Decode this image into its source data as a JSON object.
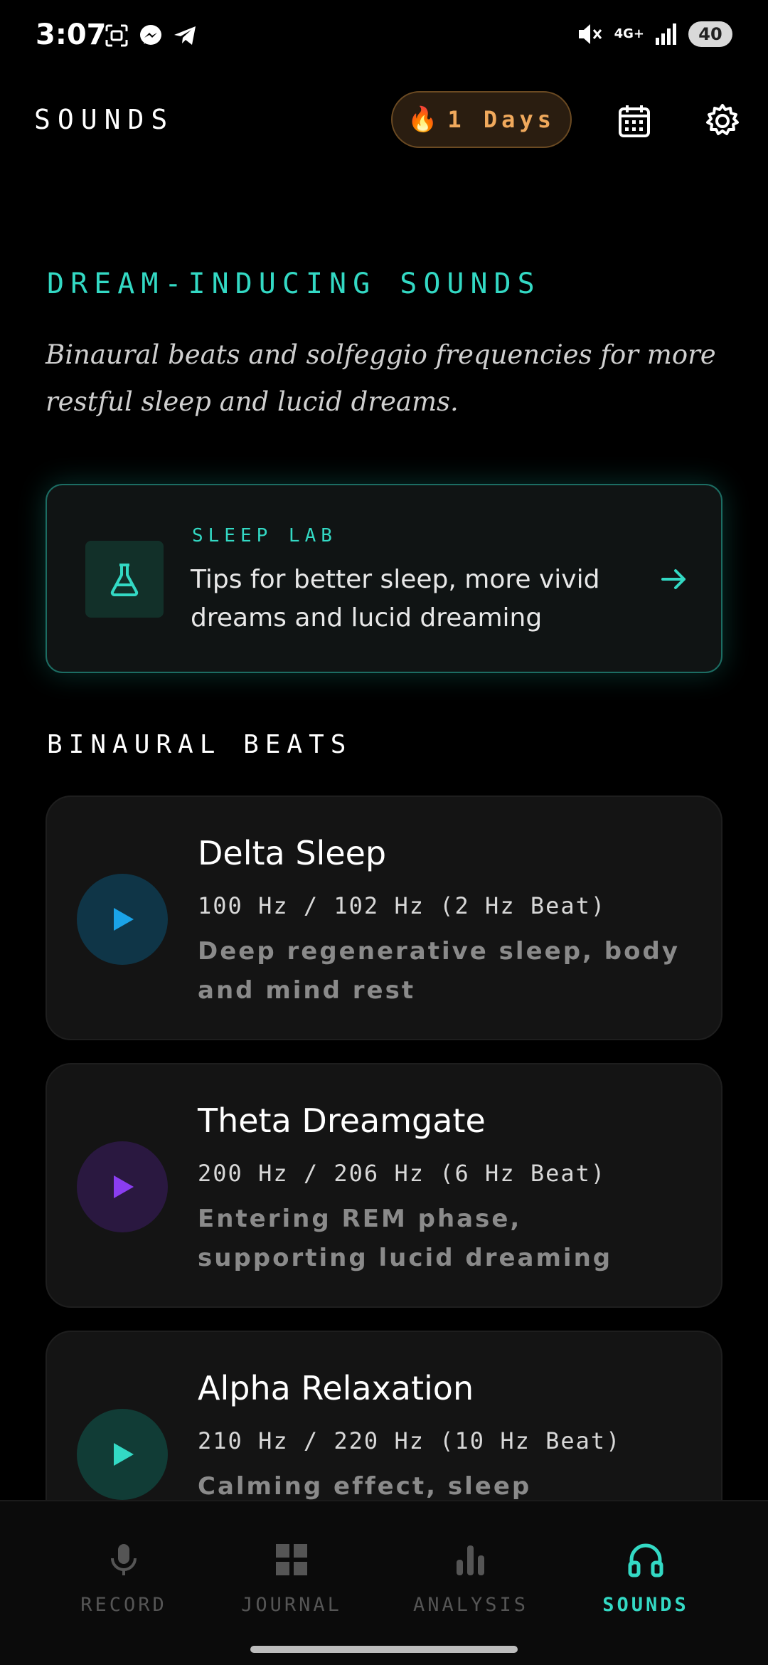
{
  "status_bar": {
    "time": "3:07",
    "network": "4G+",
    "battery": "40"
  },
  "header": {
    "title": "SOUNDS",
    "streak_label": "1 Days",
    "streak_icon": "flame-icon"
  },
  "hero": {
    "title": "DREAM-INDUCING SOUNDS",
    "description": "Binaural beats and solfeggio frequencies for more restful sleep and lucid dreams."
  },
  "sleep_lab": {
    "kicker": "SLEEP LAB",
    "text": "Tips for better sleep, more vivid dreams and lucid dreaming",
    "icon": "flask-icon"
  },
  "section": {
    "label": "BINAURAL BEATS"
  },
  "sounds": [
    {
      "name": "Delta Sleep",
      "frequency": "100 Hz / 102 Hz (2 Hz Beat)",
      "description": "Deep regenerative sleep, body and mind rest",
      "color": "#1aa3e8",
      "bg": "#0f3547"
    },
    {
      "name": "Theta Dreamgate",
      "frequency": "200 Hz / 206 Hz (6 Hz Beat)",
      "description": "Entering REM phase, supporting lucid dreaming",
      "color": "#8a3df0",
      "bg": "#2a1840"
    },
    {
      "name": "Alpha Relaxation",
      "frequency": "210 Hz / 220 Hz (10 Hz Beat)",
      "description": "Calming effect, sleep preparation",
      "color": "#33d9c4",
      "bg": "#113c36"
    }
  ],
  "nav": {
    "items": [
      {
        "label": "RECORD",
        "icon": "microphone-icon"
      },
      {
        "label": "JOURNAL",
        "icon": "grid-icon"
      },
      {
        "label": "ANALYSIS",
        "icon": "bar-chart-icon"
      },
      {
        "label": "SOUNDS",
        "icon": "headphones-icon"
      }
    ],
    "active": "SOUNDS"
  },
  "colors": {
    "accent": "#33d9c4",
    "streak": "#f0a95c"
  }
}
